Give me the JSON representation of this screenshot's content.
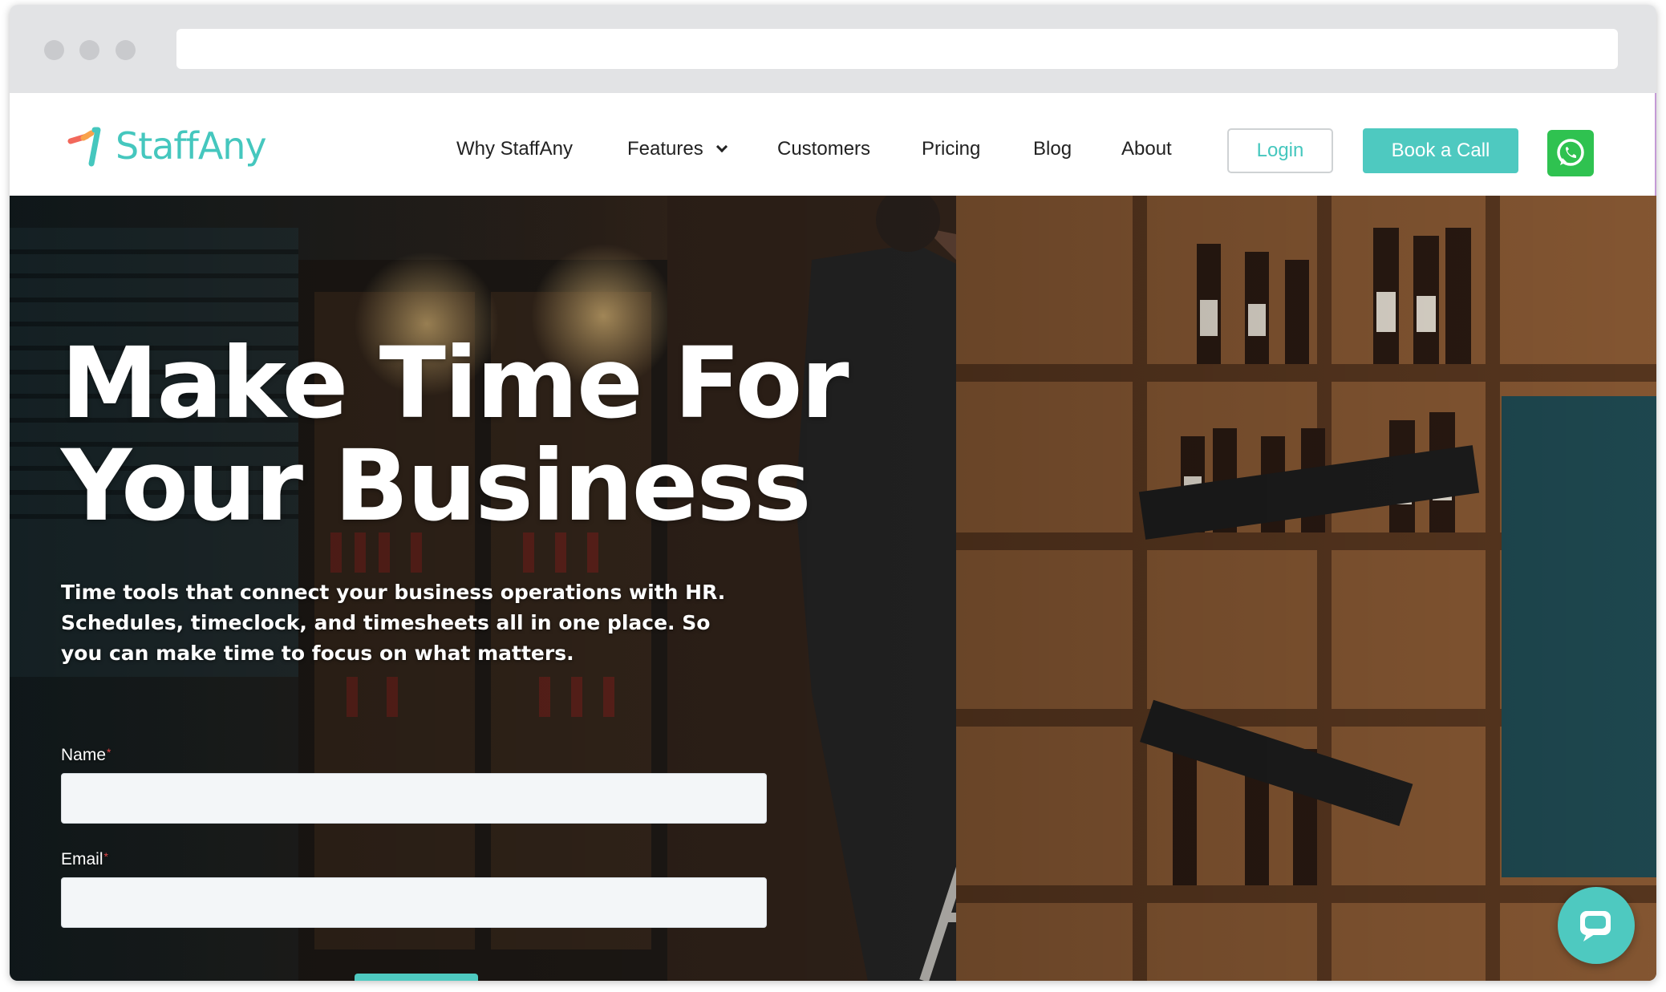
{
  "brand": {
    "name": "StaffAny",
    "accent": "#45c7be",
    "button_color": "#4ec9c0",
    "whatsapp_color": "#2fc250"
  },
  "nav": {
    "items": [
      "Why StaffAny",
      "Features",
      "Customers",
      "Pricing",
      "Blog",
      "About"
    ],
    "login_label": "Login",
    "book_label": "Book a Call",
    "whatsapp_icon": "whatsapp-icon"
  },
  "hero": {
    "title_line1": "Make Time For",
    "title_line2": "Your Business",
    "subtitle": "Time tools that connect your business operations with HR. Schedules, timeclock, and timesheets all in one place. So you can make time to focus on what matters.",
    "background": "wine-shop-photo"
  },
  "form": {
    "name_label": "Name",
    "name_value": "",
    "email_label": "Email",
    "email_value": "",
    "required_mark": "*"
  },
  "chat_widget": {
    "icon": "chat-bubble-icon"
  }
}
